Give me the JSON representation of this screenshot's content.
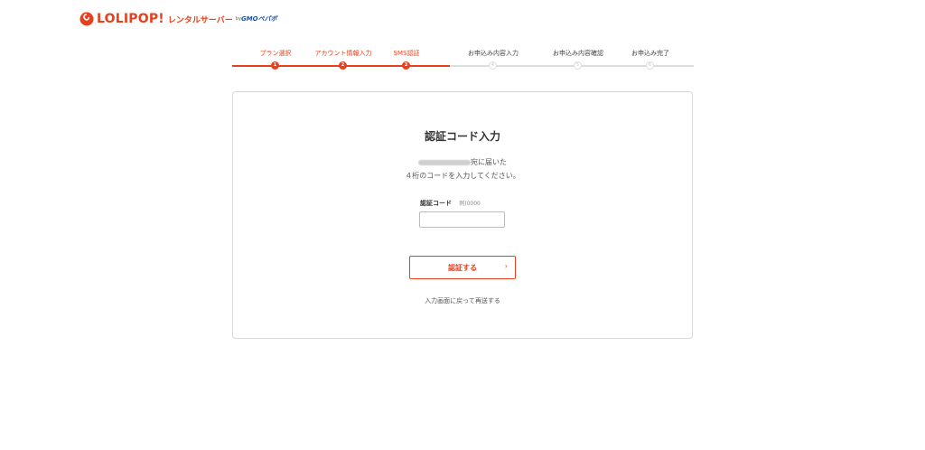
{
  "header": {
    "logo_text": "LOLIPOP!",
    "logo_sub": "レンタルサーバー",
    "logo_by": "by",
    "logo_gmo": "GMOペパボ",
    "brand_color": "#e8401c"
  },
  "steps": [
    {
      "label": "プラン選択",
      "number": "1",
      "active": true
    },
    {
      "label": "アカウント情報入力",
      "number": "2",
      "active": true
    },
    {
      "label": "SMS認証",
      "number": "3",
      "active": true
    },
    {
      "label": "お申込み内容入力",
      "number": "4",
      "active": false
    },
    {
      "label": "お申込み内容確認",
      "number": "5",
      "active": false
    },
    {
      "label": "お申込み完了",
      "number": "6",
      "active": false
    }
  ],
  "card": {
    "title": "認証コード入力",
    "desc_line1_suffix": "宛に届いた",
    "desc_line2": "４桁のコードを入力してください。",
    "field_label": "認証コード",
    "field_hint": "例)0000",
    "input_value": "",
    "submit_label": "認証する",
    "submit_icon": "chevron-right-icon",
    "resend_label": "入力画面に戻って再送する"
  }
}
